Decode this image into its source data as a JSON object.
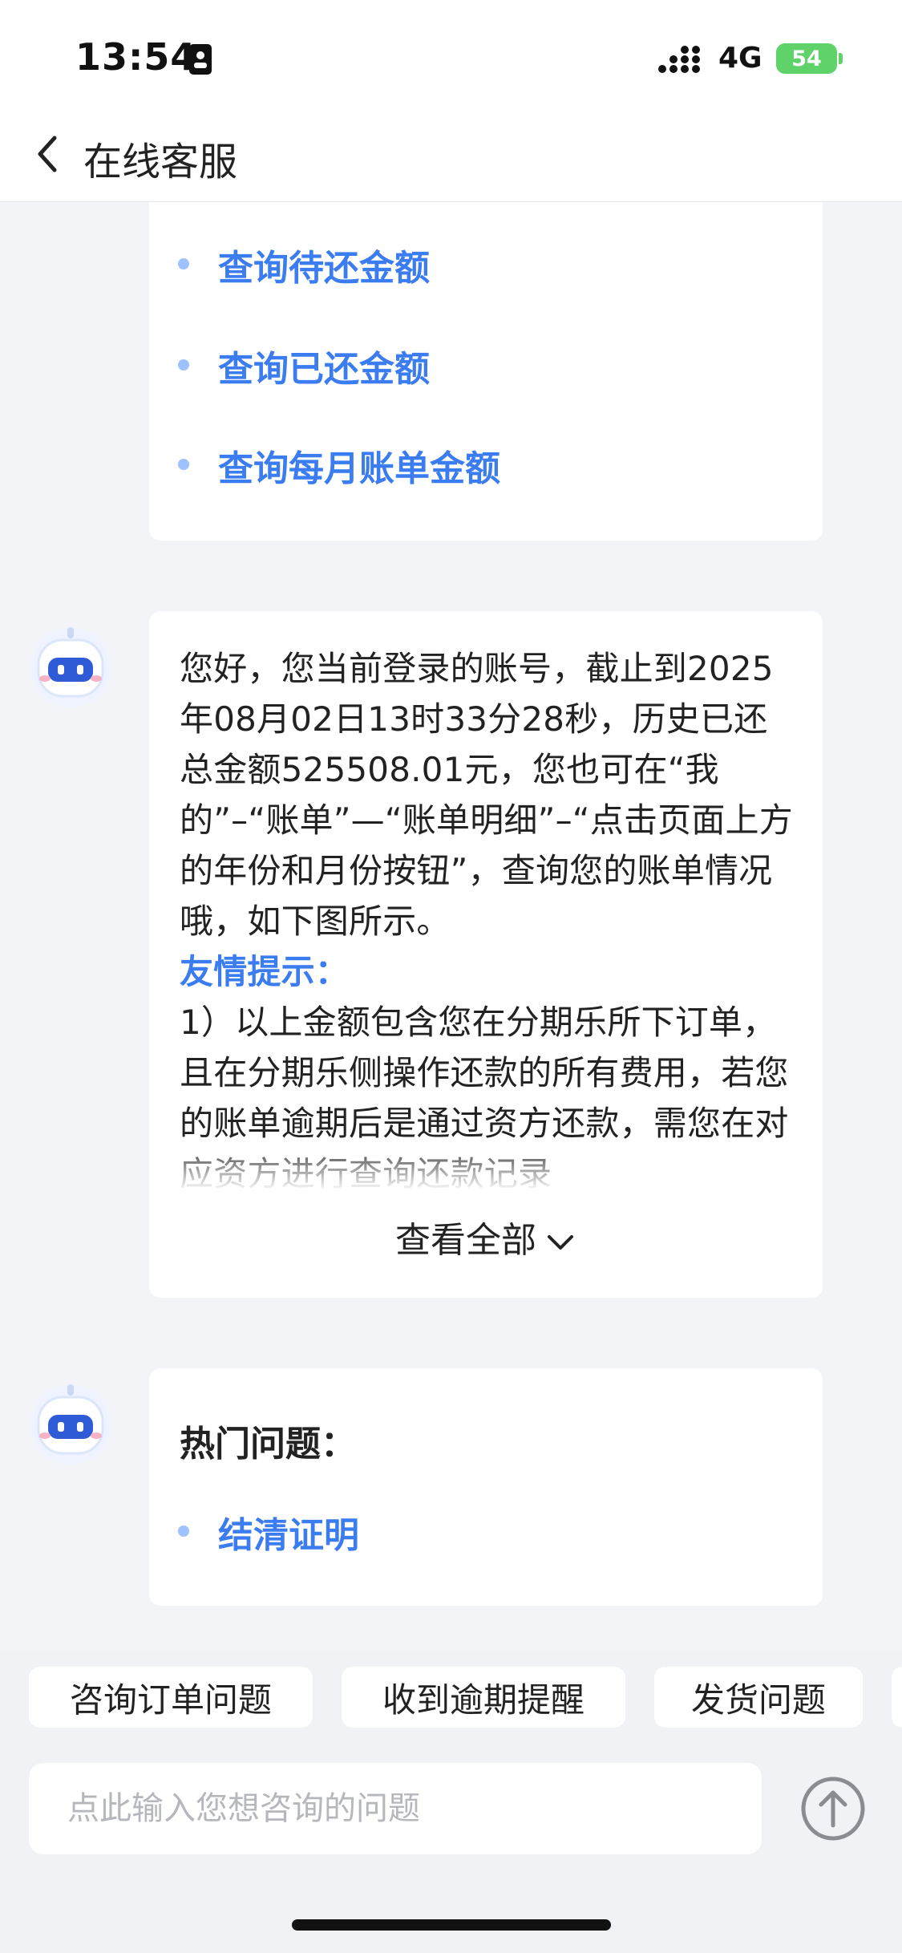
{
  "status_bar": {
    "time": "13:54",
    "network": "4G",
    "battery": "54"
  },
  "header": {
    "title": "在线客服"
  },
  "card1": {
    "links": [
      {
        "label": "查询待还金额"
      },
      {
        "label": "查询已还金额"
      },
      {
        "label": "查询每月账单金额"
      }
    ]
  },
  "card2": {
    "message": "您好，您当前登录的账号，截止到2025年08月02日13时33分28秒，历史已还总金额525508.01元，您也可在“我的”–“账单”—“账单明细”–“点击页面上方的年份和月份按钮”，查询您的账单情况哦，如下图所示。",
    "tip_title": "友情提示：",
    "tip_text": "1）以上金额包含您在分期乐所下订单，且在分期乐侧操作还款的所有费用，若您的账单逾期后是通过资方还款，需您在对应资方进行查询还款记录",
    "expand_label": "查看全部"
  },
  "card3": {
    "title": "热门问题：",
    "links": [
      {
        "label": "结清证明"
      }
    ]
  },
  "quick_chips": [
    {
      "label": "咨询订单问题"
    },
    {
      "label": "收到逾期提醒"
    },
    {
      "label": "发货问题"
    }
  ],
  "input": {
    "placeholder": "点此输入您想咨询的问题"
  },
  "icons": {
    "back": "chevron-left-icon",
    "send": "arrow-up-circle-icon",
    "expand": "chevron-down-icon",
    "avatar": "robot-icon"
  },
  "colors": {
    "accent": "#3b7cf0",
    "battery": "#5fd36a",
    "background": "#f3f4f8"
  }
}
